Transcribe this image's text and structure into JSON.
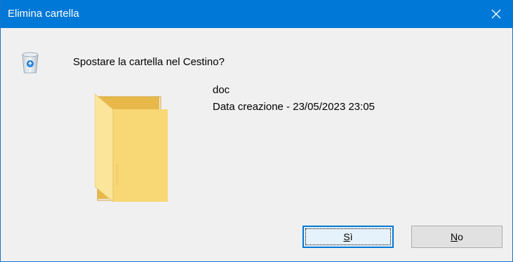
{
  "window": {
    "title": "Elimina cartella",
    "accent_color": "#0078d7"
  },
  "dialog": {
    "question": "Spostare la cartella nel Cestino?",
    "item": {
      "name": "doc",
      "date_text": "Data creazione - 23/05/2023 23:05"
    }
  },
  "buttons": {
    "yes": {
      "mnemonic": "S",
      "rest": "ì"
    },
    "no": {
      "mnemonic": "N",
      "rest": "o"
    }
  },
  "icons": {
    "close": "close-icon",
    "recycle_bin": "recycle-bin-icon",
    "folder": "folder-icon"
  }
}
